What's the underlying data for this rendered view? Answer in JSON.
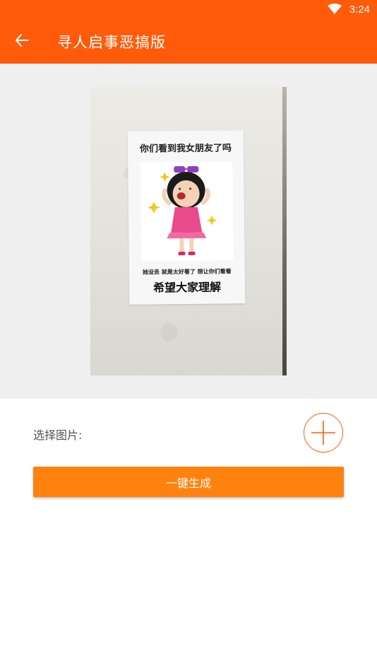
{
  "status_bar": {
    "time": "3:24",
    "wifi_icon": "wifi-icon"
  },
  "app_bar": {
    "title": "寻人启事恶搞版",
    "back_icon": "arrow-left-icon",
    "background_color": "#ff5b0a"
  },
  "preview": {
    "poster_top_text": "你们看到我女朋友了吗",
    "poster_sub_text": "她没丢 就是太好看了 想让你们看看",
    "poster_bottom_text": "希望大家理解",
    "image_description_icon": "cartoon-girl-figure"
  },
  "form": {
    "select_image_label": "选择图片:",
    "add_icon": "plus-circle-icon",
    "accent_color": "#ff5b0a"
  },
  "actions": {
    "generate_label": "一键生成",
    "button_color": "#ff820f"
  }
}
